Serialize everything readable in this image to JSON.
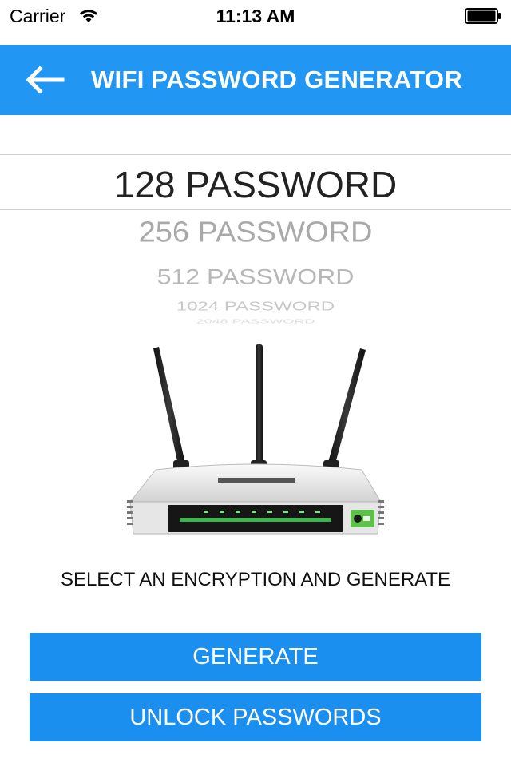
{
  "status_bar": {
    "carrier": "Carrier",
    "time": "11:13 AM",
    "wifi_icon": "wifi-icon",
    "battery_icon": "battery-full-icon"
  },
  "nav": {
    "back_icon": "back-arrow-icon",
    "title": "WIFI PASSWORD GENERATOR",
    "color": "#2196f3"
  },
  "picker": {
    "selected": "128 PASSWORD",
    "options": [
      "128 PASSWORD",
      "256 PASSWORD",
      "512 PASSWORD",
      "1024 PASSWORD",
      "2048 PASSWORD"
    ]
  },
  "router_image": "wifi-router-image",
  "instruction": "SELECT AN ENCRYPTION AND GENERATE",
  "buttons": {
    "generate": "GENERATE",
    "unlock": "UNLOCK PASSWORDS",
    "color": "#1a8ff0"
  }
}
